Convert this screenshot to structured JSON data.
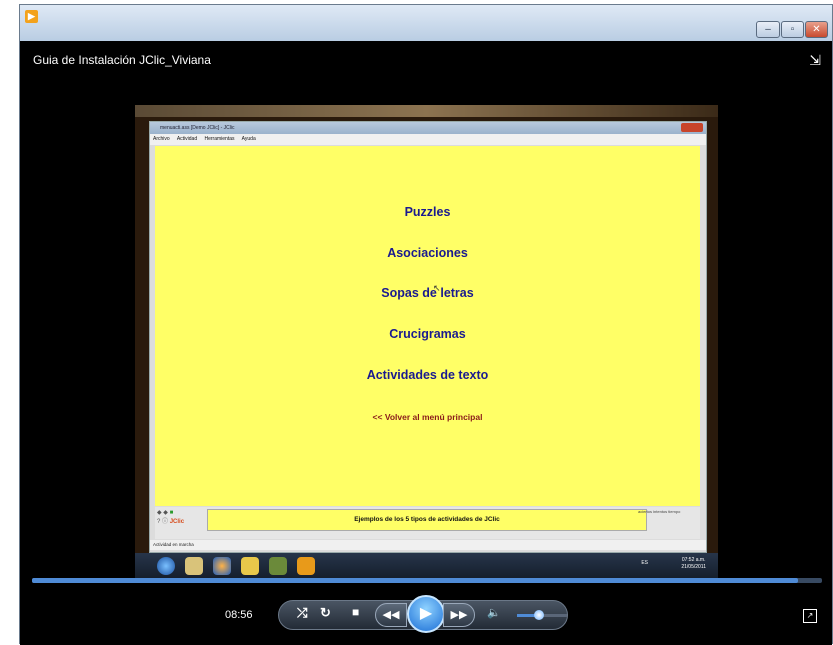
{
  "window": {
    "video_title": "Guia de Instalación JClic_Viviana",
    "minimize_glyph": "–",
    "maximize_glyph": "▫",
    "close_glyph": "✕"
  },
  "jclic": {
    "title": "menuacti.ass [Demo JClic] - JClic",
    "menu": [
      "Archivo",
      "Actividad",
      "Herramientas",
      "Ayuda"
    ],
    "items": [
      "Puzzles",
      "Asociaciones",
      "Sopas de letras",
      "Crucigramas",
      "Actividades de texto"
    ],
    "back_link": "<< Volver al menú principal",
    "status_message": "Ejemplos de los 5 tipos de actividades de JClic",
    "counters": [
      "aciertos",
      "intentos",
      "tiempo"
    ],
    "bottom_status": "Actividad en marcha"
  },
  "taskbar": {
    "lang": "ES",
    "clock_time": "07:52 a.m.",
    "clock_date": "21/05/2011"
  },
  "player": {
    "time": "08:56",
    "progress": 0.97,
    "volume": 0.45
  }
}
